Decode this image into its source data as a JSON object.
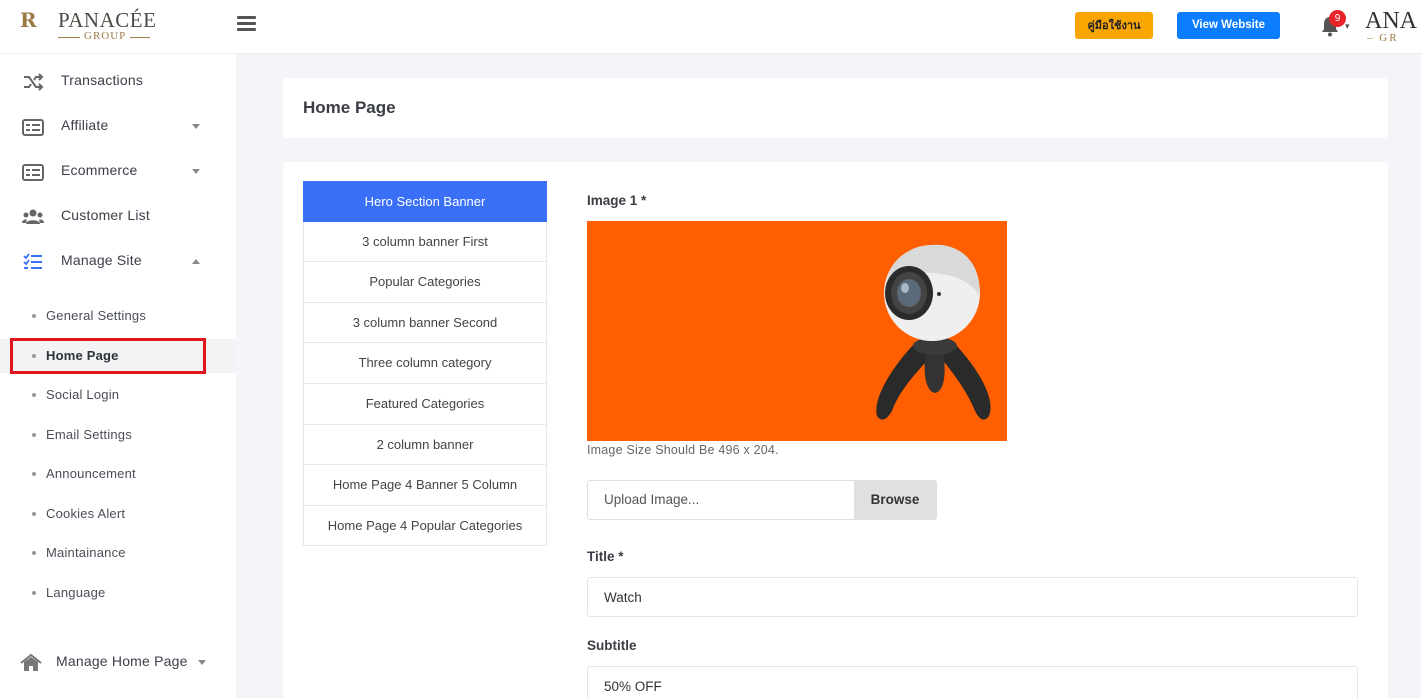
{
  "header": {
    "logo_monogram": "R",
    "logo_brand": "PANACÉE",
    "logo_group": "GROUP",
    "manual_button": "คู่มือใช้งาน",
    "view_website_button": "View Website",
    "notification_count": "9",
    "user_logo_text": "ANA",
    "user_logo_sub": "– GR",
    "manual_color": "#f9a602",
    "view_color": "#0b7dfd"
  },
  "sidebar": {
    "items": [
      {
        "label": "Transactions",
        "icon": "shuffle-icon"
      },
      {
        "label": "Affiliate",
        "icon": "list-icon"
      },
      {
        "label": "Ecommerce",
        "icon": "list-icon"
      },
      {
        "label": "Customer List",
        "icon": "users-icon"
      },
      {
        "label": "Manage Site",
        "icon": "checklist-icon"
      }
    ],
    "sub_items": [
      "General Settings",
      "Home Page",
      "Social Login",
      "Email Settings",
      "Announcement",
      "Cookies Alert",
      "Maintainance",
      "Language"
    ],
    "active_sub_item": "Home Page",
    "bottom_item": {
      "label": "Manage Home Page",
      "icon": "home-icon"
    }
  },
  "page": {
    "title": "Home Page"
  },
  "tabs": [
    "Hero Section Banner",
    "3 column banner First",
    "Popular Categories",
    "3 column banner Second",
    "Three column category",
    "Featured Categories",
    "2 column banner",
    "Home Page 4 Banner 5 Column",
    "Home Page 4 Popular Categories"
  ],
  "active_tab": "Hero Section Banner",
  "form": {
    "image_label": "Image 1 *",
    "image_hint": "Image Size Should Be 496 x 204.",
    "upload_placeholder": "Upload Image...",
    "browse_label": "Browse",
    "title_label": "Title *",
    "title_value": "Watch",
    "subtitle_label": "Subtitle",
    "subtitle_value": "50% OFF",
    "banner_color": "#ff5f00"
  }
}
